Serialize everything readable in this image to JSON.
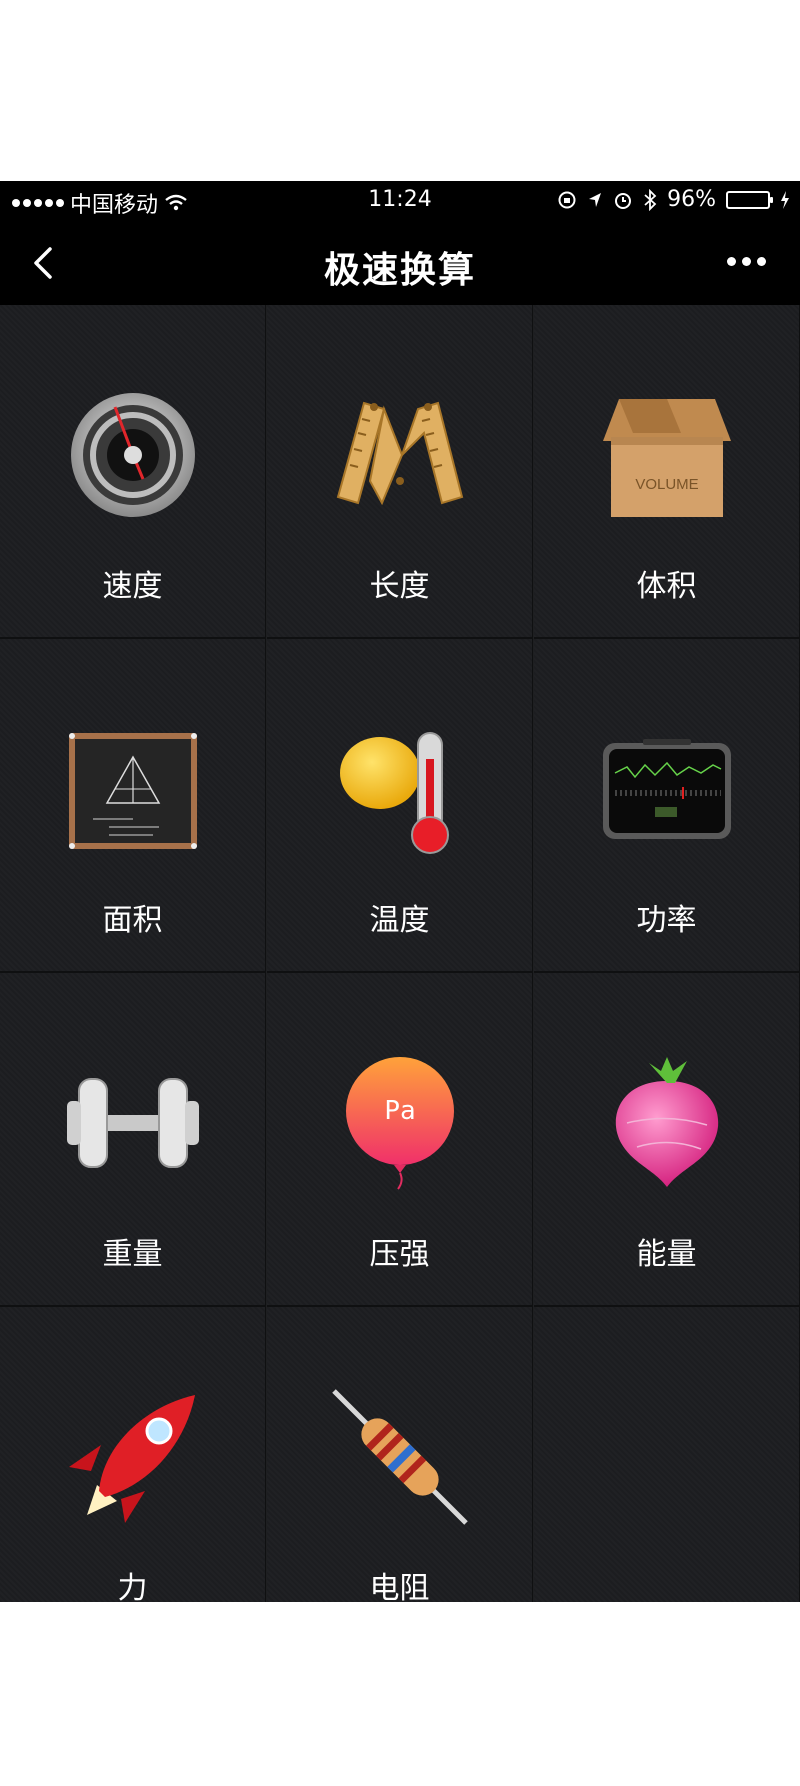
{
  "statusbar": {
    "carrier": "中国移动",
    "time": "11:24",
    "battery_percent": "96%",
    "battery_level": 0.96
  },
  "navbar": {
    "title": "极速换算",
    "back_icon": "chevron-left-icon",
    "more_icon": "more-dots-icon"
  },
  "colors": {
    "background": "#1e1f21",
    "bar": "#000000",
    "battery": "#4cd964"
  },
  "grid": {
    "items": [
      {
        "label": "速度",
        "icon": "speedometer-icon"
      },
      {
        "label": "长度",
        "icon": "ruler-icon"
      },
      {
        "label": "体积",
        "icon": "box-icon",
        "icon_text": "VOLUME"
      },
      {
        "label": "面积",
        "icon": "blackboard-icon"
      },
      {
        "label": "温度",
        "icon": "thermometer-icon"
      },
      {
        "label": "功率",
        "icon": "power-meter-icon"
      },
      {
        "label": "重量",
        "icon": "dumbbell-icon"
      },
      {
        "label": "压强",
        "icon": "balloon-icon",
        "icon_text": "Pa"
      },
      {
        "label": "能量",
        "icon": "radish-icon"
      },
      {
        "label": "力",
        "icon": "rocket-icon"
      },
      {
        "label": "电阻",
        "icon": "resistor-icon"
      }
    ]
  }
}
